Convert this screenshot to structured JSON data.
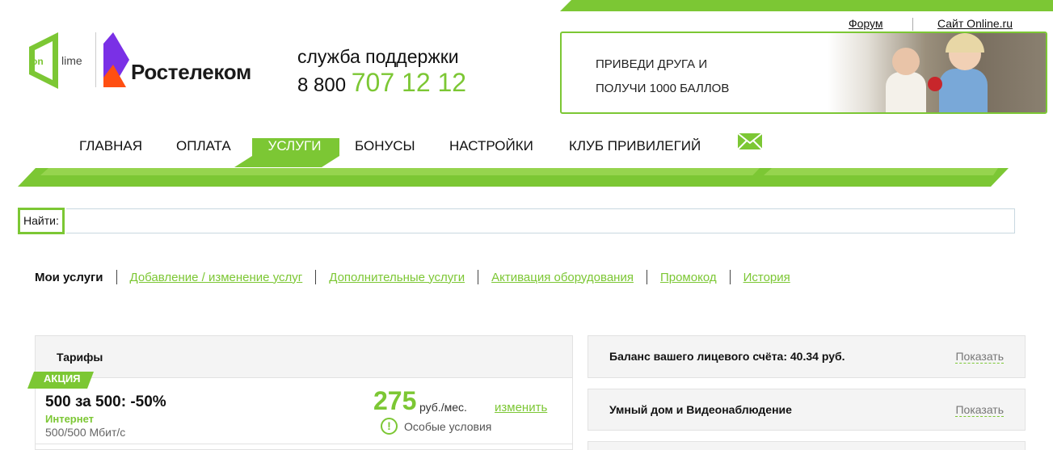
{
  "header": {
    "links": [
      "Форум",
      "Сайт Online.ru"
    ],
    "logo_onlime": {
      "on": "on",
      "lime": "lime"
    },
    "logo_rt": "Ростелеком",
    "support": {
      "title": "служба поддержки",
      "phone_prefix": "8 800",
      "phone_main": "707 12 12"
    },
    "banner": {
      "line1": "ПРИВЕДИ ДРУГА И",
      "line2": "ПОЛУЧИ 1000 БАЛЛОВ"
    }
  },
  "nav": {
    "items": [
      "ГЛАВНАЯ",
      "ОПЛАТА",
      "УСЛУГИ",
      "БОНУСЫ",
      "НАСТРОЙКИ",
      "КЛУБ ПРИВИЛЕГИЙ"
    ],
    "active": "УСЛУГИ",
    "mail_icon": "envelope-icon"
  },
  "search": {
    "label": "Найти:",
    "value": ""
  },
  "subtabs": {
    "active": "Мои услуги",
    "links": [
      "Добавление / изменение услуг",
      "Дополнительные услуги",
      "Активация оборудования",
      "Промокод",
      "История"
    ]
  },
  "tariffs": {
    "title": "Тарифы",
    "badge": "АКЦИЯ",
    "name": "500 за 500: -50%",
    "type": "Интернет",
    "speed": "500/500 Мбит/с",
    "price": "275",
    "price_unit": "руб./мес.",
    "change": "изменить",
    "special_icon": "!",
    "special": "Особые условия"
  },
  "right_panels": [
    {
      "title": "Баланс вашего лицевого счёта: 40.34 руб.",
      "action": "Показать"
    },
    {
      "title": "Умный дом и Видеонаблюдение",
      "action": "Показать"
    }
  ],
  "colors": {
    "accent": "#7cc734",
    "accent_light": "#96d44e",
    "rostelecom_purple": "#7a30e6",
    "rostelecom_orange": "#ff4f12"
  }
}
